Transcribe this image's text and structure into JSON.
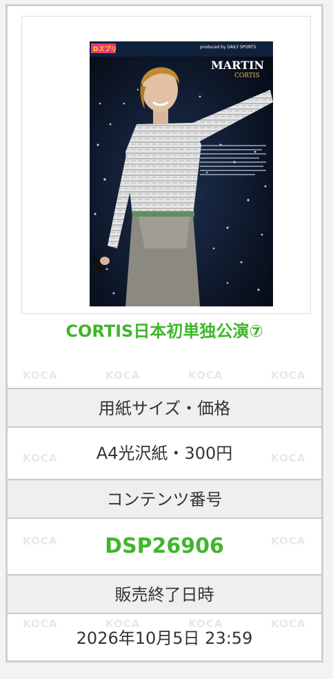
{
  "product": {
    "title": "CORTIS日本初単独公演⑦",
    "photo_alt": "MARTIN CORTIS live performance photo"
  },
  "photo_text": {
    "brand": "Dスプリ",
    "name": "MARTIN",
    "group": "CORTIS",
    "credit": "produced by DAILY SPORTS"
  },
  "details": {
    "size_price_label": "用紙サイズ・価格",
    "size_price_value": "A4光沢紙・300円",
    "content_number_label": "コンテンツ番号",
    "content_number_value": "DSP26906",
    "sale_end_label": "販売終了日時",
    "sale_end_value": "2026年10月5日 23:59"
  },
  "watermark_text": "KOCA",
  "colors": {
    "accent_green": "#3fb62a",
    "header_bg": "#efefef",
    "border": "#c9c9c9",
    "text": "#333333"
  }
}
